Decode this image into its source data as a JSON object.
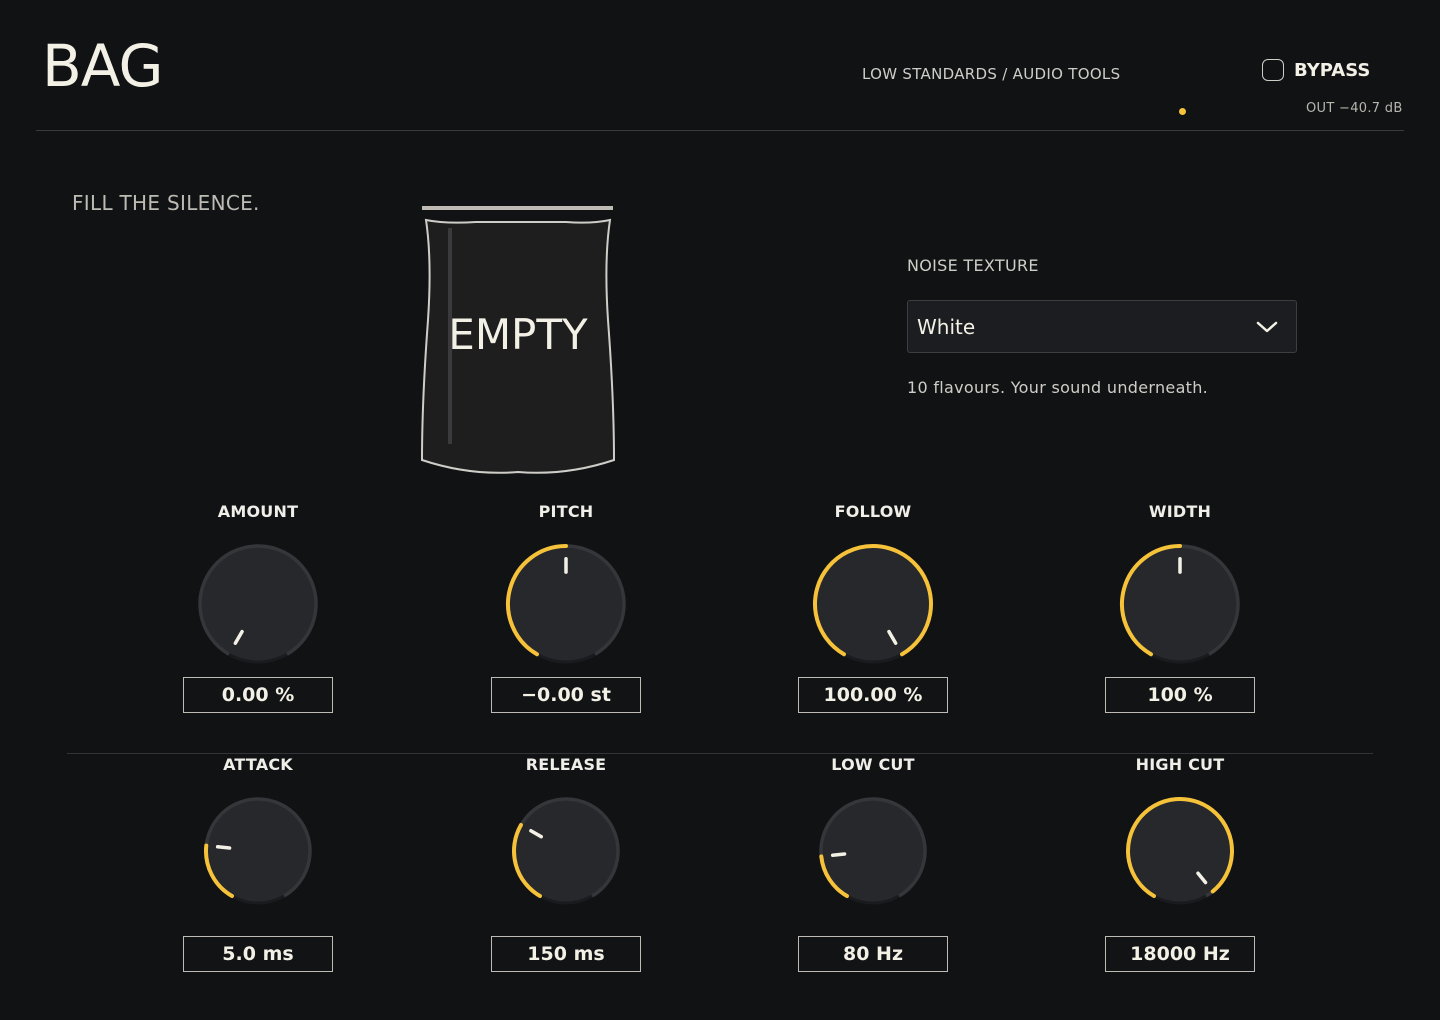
{
  "header": {
    "app_title": "BAG",
    "brand": "LOW STANDARDS / AUDIO TOOLS",
    "bypass_label": "BYPASS",
    "output_readout": "OUT  −40.7 dB"
  },
  "tagline": "FILL THE SILENCE.",
  "bag": {
    "label": "EMPTY"
  },
  "noise_texture": {
    "label": "NOISE TEXTURE",
    "selected": "White",
    "description": "10 flavours. Your sound underneath."
  },
  "colors": {
    "accent": "#f5c23a",
    "background": "#111214",
    "knob_face": "#26282c"
  },
  "knobs_row1": [
    {
      "label": "AMOUNT",
      "value": "0.00 %",
      "level": 0.0
    },
    {
      "label": "PITCH",
      "value": "−0.00 st",
      "level": 0.5
    },
    {
      "label": "FOLLOW",
      "value": "100.00 %",
      "level": 1.0
    },
    {
      "label": "WIDTH",
      "value": "100 %",
      "level": 0.5
    }
  ],
  "knobs_row2": [
    {
      "label": "ATTACK",
      "value": "5.0 ms",
      "level": 0.22
    },
    {
      "label": "RELEASE",
      "value": "150 ms",
      "level": 0.3
    },
    {
      "label": "LOW CUT",
      "value": "80 Hz",
      "level": 0.18
    },
    {
      "label": "HIGH CUT",
      "value": "18000 Hz",
      "level": 0.97
    }
  ]
}
